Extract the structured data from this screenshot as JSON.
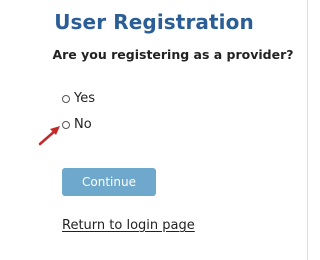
{
  "page": {
    "title": "User Registration",
    "question": "Are you registering as a provider?"
  },
  "options": [
    {
      "label": "Yes",
      "selected": false
    },
    {
      "label": "No",
      "selected": false
    }
  ],
  "actions": {
    "continue_label": "Continue",
    "return_label": "Return to login page"
  },
  "annotations": {
    "arrow_color": "#c62828",
    "target": "No"
  },
  "colors": {
    "title": "#2b5d96",
    "button": "#6ea9cd",
    "text": "#222222"
  }
}
